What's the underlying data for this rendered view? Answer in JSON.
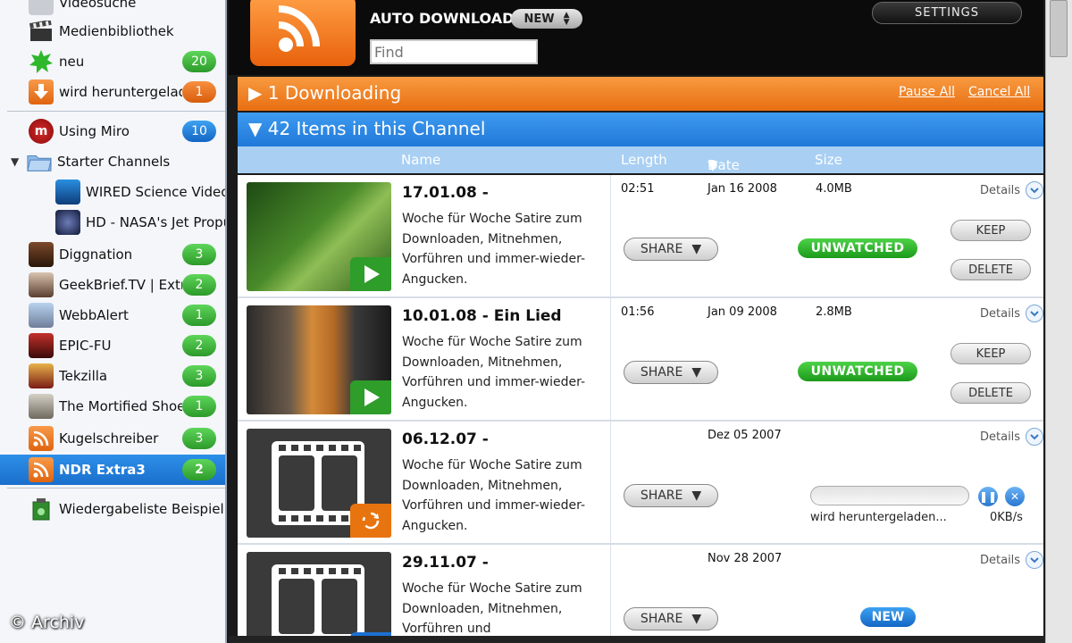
{
  "sidebar": {
    "items": [
      {
        "label": "Videosuche",
        "count": ""
      },
      {
        "label": "Medienbibliothek",
        "count": ""
      },
      {
        "label": "neu",
        "count": "20"
      },
      {
        "label": "wird heruntergeladen",
        "count": "1"
      },
      {
        "label": "Using Miro",
        "count": "10"
      },
      {
        "label": "Starter Channels",
        "count": ""
      },
      {
        "label": "WIRED Science Video",
        "count": ""
      },
      {
        "label": "HD - NASA's Jet Propulsion",
        "count": ""
      },
      {
        "label": "Diggnation",
        "count": "3"
      },
      {
        "label": "GeekBrief.TV | Extra",
        "count": "2"
      },
      {
        "label": "WebbAlert",
        "count": "1"
      },
      {
        "label": "EPIC-FU",
        "count": "2"
      },
      {
        "label": "Tekzilla",
        "count": "3"
      },
      {
        "label": "The Mortified Shoebox",
        "count": "1"
      },
      {
        "label": "Kugelschreiber",
        "count": "3"
      },
      {
        "label": "NDR Extra3",
        "count": "2"
      },
      {
        "label": "Wiedergabeliste Beispiel",
        "count": ""
      }
    ]
  },
  "watermark": "© Archiv",
  "header": {
    "auto_download_label": "AUTO DOWNLOAD",
    "auto_download_value": "NEW",
    "find_placeholder": "Find",
    "settings_label": "SETTINGS"
  },
  "downloading": {
    "label": "1 Downloading",
    "pause_all": "Pause All",
    "cancel_all": "Cancel All"
  },
  "channel": {
    "label": "42 Items in this Channel"
  },
  "columns": {
    "name": "Name",
    "length": "Length",
    "date": "Date",
    "size": "Size"
  },
  "items": [
    {
      "title": "17.01.08 -",
      "desc": "Woche für Woche Satire zum Downloaden, Mitnehmen, Vorführen und immer-wieder-Angucken.",
      "length": "02:51",
      "date": "Jan 16 2008",
      "size": "4.0MB",
      "details": "Details",
      "share": "SHARE",
      "status": "UNWATCHED",
      "keep": "KEEP",
      "delete": "DELETE"
    },
    {
      "title": "10.01.08 - Ein Lied",
      "desc": "Woche für Woche Satire zum Downloaden, Mitnehmen, Vorführen und immer-wieder-Angucken.",
      "length": "01:56",
      "date": "Jan 09 2008",
      "size": "2.8MB",
      "details": "Details",
      "share": "SHARE",
      "status": "UNWATCHED",
      "keep": "KEEP",
      "delete": "DELETE"
    },
    {
      "title": "06.12.07 -",
      "desc": "Woche für Woche Satire zum Downloaden, Mitnehmen, Vorführen und immer-wieder-Angucken.",
      "date": "Dez 05 2007",
      "details": "Details",
      "share": "SHARE",
      "download_status": "wird heruntergeladen...",
      "download_rate": "0KB/s"
    },
    {
      "title": "29.11.07 -",
      "desc": "Woche für Woche Satire zum Downloaden, Mitnehmen, Vorführen und",
      "date": "Nov 28 2007",
      "details": "Details",
      "share": "SHARE",
      "status": "NEW"
    }
  ]
}
